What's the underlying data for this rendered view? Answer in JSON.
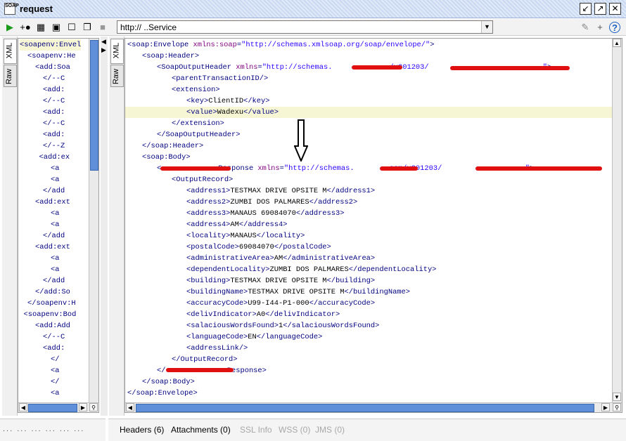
{
  "window": {
    "title": "request",
    "app_icon_text": "SOAP"
  },
  "toolbar": {
    "url": "http://                                                  ..Service",
    "icons": [
      "play-icon",
      "add-assertion-icon",
      "format-icon",
      "fullscreen-icon",
      "split-h-icon",
      "split-v-icon",
      "stop-icon"
    ]
  },
  "left": {
    "tabs": [
      "XML",
      "Raw"
    ],
    "lines": [
      {
        "i": 0,
        "t": "<soapenv:Envel"
      },
      {
        "i": 2,
        "t": "<soapenv:He"
      },
      {
        "i": 4,
        "t": "<add:Soa"
      },
      {
        "i": 6,
        "t": "</--C"
      },
      {
        "i": 6,
        "t": "<add:"
      },
      {
        "i": 6,
        "t": "</--C"
      },
      {
        "i": 6,
        "t": "<add:"
      },
      {
        "i": 6,
        "t": "</--C"
      },
      {
        "i": 6,
        "t": "<add:"
      },
      {
        "i": 6,
        "t": "</--Z"
      },
      {
        "i": 5,
        "t": "<add:ex"
      },
      {
        "i": 8,
        "t": "<a"
      },
      {
        "i": 8,
        "t": "<a"
      },
      {
        "i": 6,
        "t": "</add"
      },
      {
        "i": 4,
        "t": "<add:ext"
      },
      {
        "i": 8,
        "t": "<a"
      },
      {
        "i": 8,
        "t": "<a"
      },
      {
        "i": 6,
        "t": "</add"
      },
      {
        "i": 4,
        "t": "<add:ext"
      },
      {
        "i": 8,
        "t": "<a"
      },
      {
        "i": 8,
        "t": "<a"
      },
      {
        "i": 6,
        "t": "</add"
      },
      {
        "i": 4,
        "t": "</add:So"
      },
      {
        "i": 2,
        "t": "</soapenv:H"
      },
      {
        "i": 1,
        "t": "<soapenv:Bod"
      },
      {
        "i": 4,
        "t": "<add:Add"
      },
      {
        "i": 6,
        "t": "</--C"
      },
      {
        "i": 6,
        "t": "<add:"
      },
      {
        "i": 8,
        "t": "</"
      },
      {
        "i": 8,
        "t": "<a"
      },
      {
        "i": 8,
        "t": "</"
      },
      {
        "i": 8,
        "t": "<a"
      }
    ]
  },
  "right": {
    "tabs": [
      "XML",
      "Raw"
    ],
    "lines": [
      {
        "i": 0,
        "p": [
          [
            "tag",
            "<soap:Envelope "
          ],
          [
            "attr",
            "xmlns:soap"
          ],
          [
            "tag",
            "="
          ],
          [
            "val",
            "\"http://schemas.xmlsoap.org/soap/envelope/\""
          ],
          [
            "tag",
            ">"
          ]
        ]
      },
      {
        "i": 2,
        "p": [
          [
            "tag",
            "<soap:Header>"
          ]
        ]
      },
      {
        "i": 4,
        "p": [
          [
            "tag",
            "<SoapOutputHeader "
          ],
          [
            "attr",
            "xmlns"
          ],
          [
            "tag",
            "="
          ],
          [
            "val",
            "\"http://schemas.             /v201203/                          \""
          ],
          [
            "tag",
            ">"
          ]
        ]
      },
      {
        "i": 6,
        "p": [
          [
            "tag",
            "<parentTransactionID/>"
          ]
        ]
      },
      {
        "i": 6,
        "p": [
          [
            "tag",
            "<extension>"
          ]
        ]
      },
      {
        "i": 8,
        "p": [
          [
            "tag",
            "<key>"
          ],
          [
            "txt",
            "ClientID"
          ],
          [
            "tag",
            "</key>"
          ]
        ]
      },
      {
        "i": 8,
        "hl": true,
        "p": [
          [
            "tag",
            "<value>"
          ],
          [
            "txt",
            "Wadexu"
          ],
          [
            "tag",
            "</value>"
          ]
        ]
      },
      {
        "i": 6,
        "p": [
          [
            "tag",
            "</extension>"
          ]
        ]
      },
      {
        "i": 4,
        "p": [
          [
            "tag",
            "</SoapOutputHeader>"
          ]
        ]
      },
      {
        "i": 2,
        "p": [
          [
            "tag",
            "</soap:Header>"
          ]
        ]
      },
      {
        "i": 2,
        "p": [
          [
            "tag",
            "<soap:Body>"
          ]
        ]
      },
      {
        "i": 4,
        "p": [
          [
            "tag",
            "<             Response "
          ],
          [
            "attr",
            "xmlns"
          ],
          [
            "tag",
            "="
          ],
          [
            "val",
            "\"http://schemas.        com/v201203/                   \""
          ],
          [
            "tag",
            ">"
          ]
        ]
      },
      {
        "i": 6,
        "p": [
          [
            "tag",
            "<OutputRecord>"
          ]
        ]
      },
      {
        "i": 8,
        "p": [
          [
            "tag",
            "<address1>"
          ],
          [
            "txt",
            "TESTMAX DRIVE OPSITE M"
          ],
          [
            "tag",
            "</address1>"
          ]
        ]
      },
      {
        "i": 8,
        "p": [
          [
            "tag",
            "<address2>"
          ],
          [
            "txt",
            "ZUMBI DOS PALMARES"
          ],
          [
            "tag",
            "</address2>"
          ]
        ]
      },
      {
        "i": 8,
        "p": [
          [
            "tag",
            "<address3>"
          ],
          [
            "txt",
            "MANAUS 69084070"
          ],
          [
            "tag",
            "</address3>"
          ]
        ]
      },
      {
        "i": 8,
        "p": [
          [
            "tag",
            "<address4>"
          ],
          [
            "txt",
            "AM"
          ],
          [
            "tag",
            "</address4>"
          ]
        ]
      },
      {
        "i": 8,
        "p": [
          [
            "tag",
            "<locality>"
          ],
          [
            "txt",
            "MANAUS"
          ],
          [
            "tag",
            "</locality>"
          ]
        ]
      },
      {
        "i": 8,
        "p": [
          [
            "tag",
            "<postalCode>"
          ],
          [
            "txt",
            "69084070"
          ],
          [
            "tag",
            "</postalCode>"
          ]
        ]
      },
      {
        "i": 8,
        "p": [
          [
            "tag",
            "<administrativeArea>"
          ],
          [
            "txt",
            "AM"
          ],
          [
            "tag",
            "</administrativeArea>"
          ]
        ]
      },
      {
        "i": 8,
        "p": [
          [
            "tag",
            "<dependentLocality>"
          ],
          [
            "txt",
            "ZUMBI DOS PALMARES"
          ],
          [
            "tag",
            "</dependentLocality>"
          ]
        ]
      },
      {
        "i": 8,
        "p": [
          [
            "tag",
            "<building>"
          ],
          [
            "txt",
            "TESTMAX DRIVE OPSITE M"
          ],
          [
            "tag",
            "</building>"
          ]
        ]
      },
      {
        "i": 8,
        "p": [
          [
            "tag",
            "<buildingName>"
          ],
          [
            "txt",
            "TESTMAX DRIVE OPSITE M"
          ],
          [
            "tag",
            "</buildingName>"
          ]
        ]
      },
      {
        "i": 8,
        "p": [
          [
            "tag",
            "<accuracyCode>"
          ],
          [
            "txt",
            "U99-I44-P1-000"
          ],
          [
            "tag",
            "</accuracyCode>"
          ]
        ]
      },
      {
        "i": 8,
        "p": [
          [
            "tag",
            "<delivIndicator>"
          ],
          [
            "txt",
            "A0"
          ],
          [
            "tag",
            "</delivIndicator>"
          ]
        ]
      },
      {
        "i": 8,
        "p": [
          [
            "tag",
            "<salaciousWordsFound>"
          ],
          [
            "txt",
            "1"
          ],
          [
            "tag",
            "</salaciousWordsFound>"
          ]
        ]
      },
      {
        "i": 8,
        "p": [
          [
            "tag",
            "<languageCode>"
          ],
          [
            "txt",
            "EN"
          ],
          [
            "tag",
            "</languageCode>"
          ]
        ]
      },
      {
        "i": 8,
        "p": [
          [
            "tag",
            "<addressLink/>"
          ]
        ]
      },
      {
        "i": 6,
        "p": [
          [
            "tag",
            "</OutputRecord>"
          ]
        ]
      },
      {
        "i": 4,
        "p": [
          [
            "tag",
            "</              Response>"
          ]
        ]
      },
      {
        "i": 2,
        "p": [
          [
            "tag",
            "</soap:Body>"
          ]
        ]
      },
      {
        "i": 0,
        "p": [
          [
            "tag",
            "</soap:Envelope>"
          ]
        ]
      }
    ]
  },
  "bottom_tabs": [
    {
      "label": "Headers (6)",
      "enabled": true
    },
    {
      "label": "Attachments (0)",
      "enabled": true
    },
    {
      "label": "SSL Info",
      "enabled": false
    },
    {
      "label": "WSS (0)",
      "enabled": false
    },
    {
      "label": "JMS (0)",
      "enabled": false
    }
  ],
  "left_status": "... ... ... ... ... ..."
}
